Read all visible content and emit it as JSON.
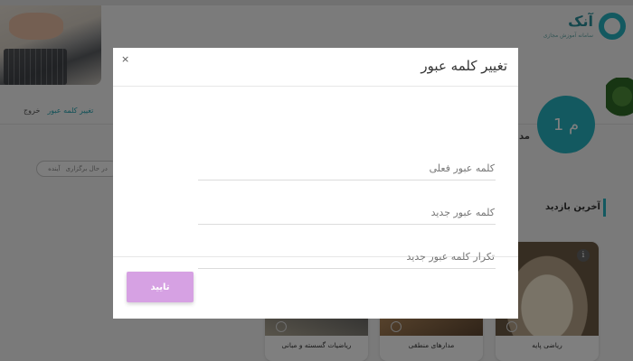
{
  "background": {
    "brand": {
      "name": "آنک",
      "tagline": "سامانه آموزش مجازی"
    },
    "hero_links": {
      "change_password": "تغییر کلمه عبور",
      "logout": "خروج"
    },
    "avatar": {
      "initials": "م 1",
      "side_text": "مد"
    },
    "filter": {
      "label_active": "در حال برگزاری",
      "label_other": "آینده"
    },
    "recent": {
      "title": "آخرین بازدید"
    },
    "courses": [
      {
        "name": "ریاضی پایه",
        "thumb": "book"
      },
      {
        "name": "مدارهای منطقی",
        "thumb": "wood"
      },
      {
        "name": "ریاضیات گسسته و مبانی",
        "thumb": "stone"
      }
    ],
    "colors": {
      "accent": "#27b3c0",
      "overlay": "rgba(0,0,0,0.5)"
    }
  },
  "modal": {
    "title": "تغییر کلمه عبور",
    "close_icon": "×",
    "fields": {
      "current_password": {
        "placeholder": "کلمه عبور فعلی",
        "value": ""
      },
      "new_password": {
        "placeholder": "کلمه عبور جدید",
        "value": ""
      },
      "confirm_password": {
        "placeholder": "تکرار کلمه عبور جدید",
        "value": ""
      }
    },
    "confirm_label": "تایید",
    "confirm_color": "#d6a1e3"
  }
}
